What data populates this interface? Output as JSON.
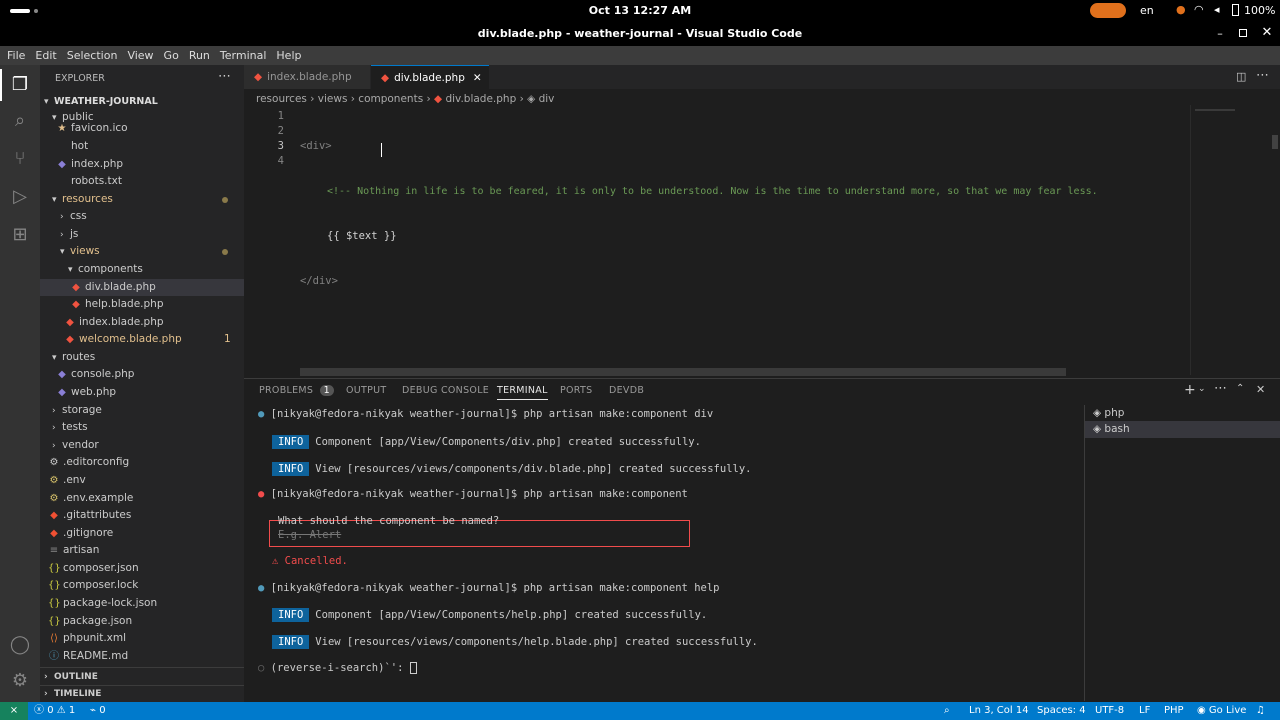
{
  "system": {
    "datetime": "Oct 13 12:27 AM",
    "lang": "en",
    "battery": "100%"
  },
  "window": {
    "title": "div.blade.php - weather-journal - Visual Studio Code"
  },
  "menu": [
    "File",
    "Edit",
    "Selection",
    "View",
    "Go",
    "Run",
    "Terminal",
    "Help"
  ],
  "explorer": {
    "title": "EXPLORER",
    "root": "WEATHER-JOURNAL",
    "items": [
      {
        "label": "public",
        "type": "folder"
      },
      {
        "label": "favicon.ico",
        "type": "file"
      },
      {
        "label": "hot",
        "type": "file"
      },
      {
        "label": "index.php",
        "type": "file"
      },
      {
        "label": "robots.txt",
        "type": "file"
      },
      {
        "label": "resources",
        "type": "folder"
      },
      {
        "label": "css",
        "type": "folder"
      },
      {
        "label": "js",
        "type": "folder"
      },
      {
        "label": "views",
        "type": "folder"
      },
      {
        "label": "components",
        "type": "folder"
      },
      {
        "label": "div.blade.php",
        "type": "file"
      },
      {
        "label": "help.blade.php",
        "type": "file"
      },
      {
        "label": "index.blade.php",
        "type": "file"
      },
      {
        "label": "welcome.blade.php",
        "type": "file",
        "badge": "1"
      },
      {
        "label": "routes",
        "type": "folder"
      },
      {
        "label": "console.php",
        "type": "file"
      },
      {
        "label": "web.php",
        "type": "file"
      },
      {
        "label": "storage",
        "type": "folder"
      },
      {
        "label": "tests",
        "type": "folder"
      },
      {
        "label": "vendor",
        "type": "folder"
      },
      {
        "label": ".editorconfig",
        "type": "file"
      },
      {
        "label": ".env",
        "type": "file"
      },
      {
        "label": ".env.example",
        "type": "file"
      },
      {
        "label": ".gitattributes",
        "type": "file"
      },
      {
        "label": ".gitignore",
        "type": "file"
      },
      {
        "label": "artisan",
        "type": "file"
      },
      {
        "label": "composer.json",
        "type": "file"
      },
      {
        "label": "composer.lock",
        "type": "file"
      },
      {
        "label": "package-lock.json",
        "type": "file"
      },
      {
        "label": "package.json",
        "type": "file"
      },
      {
        "label": "phpunit.xml",
        "type": "file"
      },
      {
        "label": "README.md",
        "type": "file"
      }
    ],
    "outline": "OUTLINE",
    "timeline": "TIMELINE"
  },
  "tabs": [
    {
      "label": "index.blade.php"
    },
    {
      "label": "div.blade.php"
    }
  ],
  "breadcrumb": [
    "resources",
    "views",
    "components",
    "div.blade.php",
    "div"
  ],
  "code": {
    "line_numbers": [
      "1",
      "2",
      "3",
      "4"
    ],
    "line1": "<div>",
    "line2": "<!-- Nothing in life is to be feared, it is only to be understood. Now is the time to understand more, so that we may fear less.",
    "line3": "{{ $text }}",
    "line4": "</div>"
  },
  "panel": {
    "tabs": [
      "PROBLEMS",
      "OUTPUT",
      "DEBUG CONSOLE",
      "TERMINAL",
      "PORTS",
      "DEVDB"
    ],
    "problems_count": "1",
    "terminals": [
      "php",
      "bash"
    ]
  },
  "terminal": {
    "prompt1": "[nikyak@fedora-nikyak weather-journal]$ php artisan make:component div",
    "info": "INFO",
    "l1": "Component [app/View/Components/div.php] created successfully.",
    "l2": "View [resources/views/components/div.blade.php] created successfully.",
    "prompt2": "[nikyak@fedora-nikyak weather-journal]$ php artisan make:component",
    "question": "What should the component be named?",
    "placeholder": "E.g. Alert",
    "cancelled": "⚠ Cancelled.",
    "prompt3": "[nikyak@fedora-nikyak weather-journal]$ php artisan make:component help",
    "l3": "Component [app/View/Components/help.php] created successfully.",
    "l4": "View [resources/views/components/help.blade.php] created successfully.",
    "search": "(reverse-i-search)`':"
  },
  "status": {
    "errors": "0",
    "warnings": "1",
    "ports": "0",
    "position": "Ln 3, Col 14",
    "spaces": "Spaces: 4",
    "encoding": "UTF-8",
    "eol": "LF",
    "language": "PHP",
    "golive": "Go Live"
  },
  "colors": {
    "accent": "#007acc",
    "folder": "#e2c08d",
    "info_badge": "#0e639c",
    "error": "#f14c4c"
  }
}
